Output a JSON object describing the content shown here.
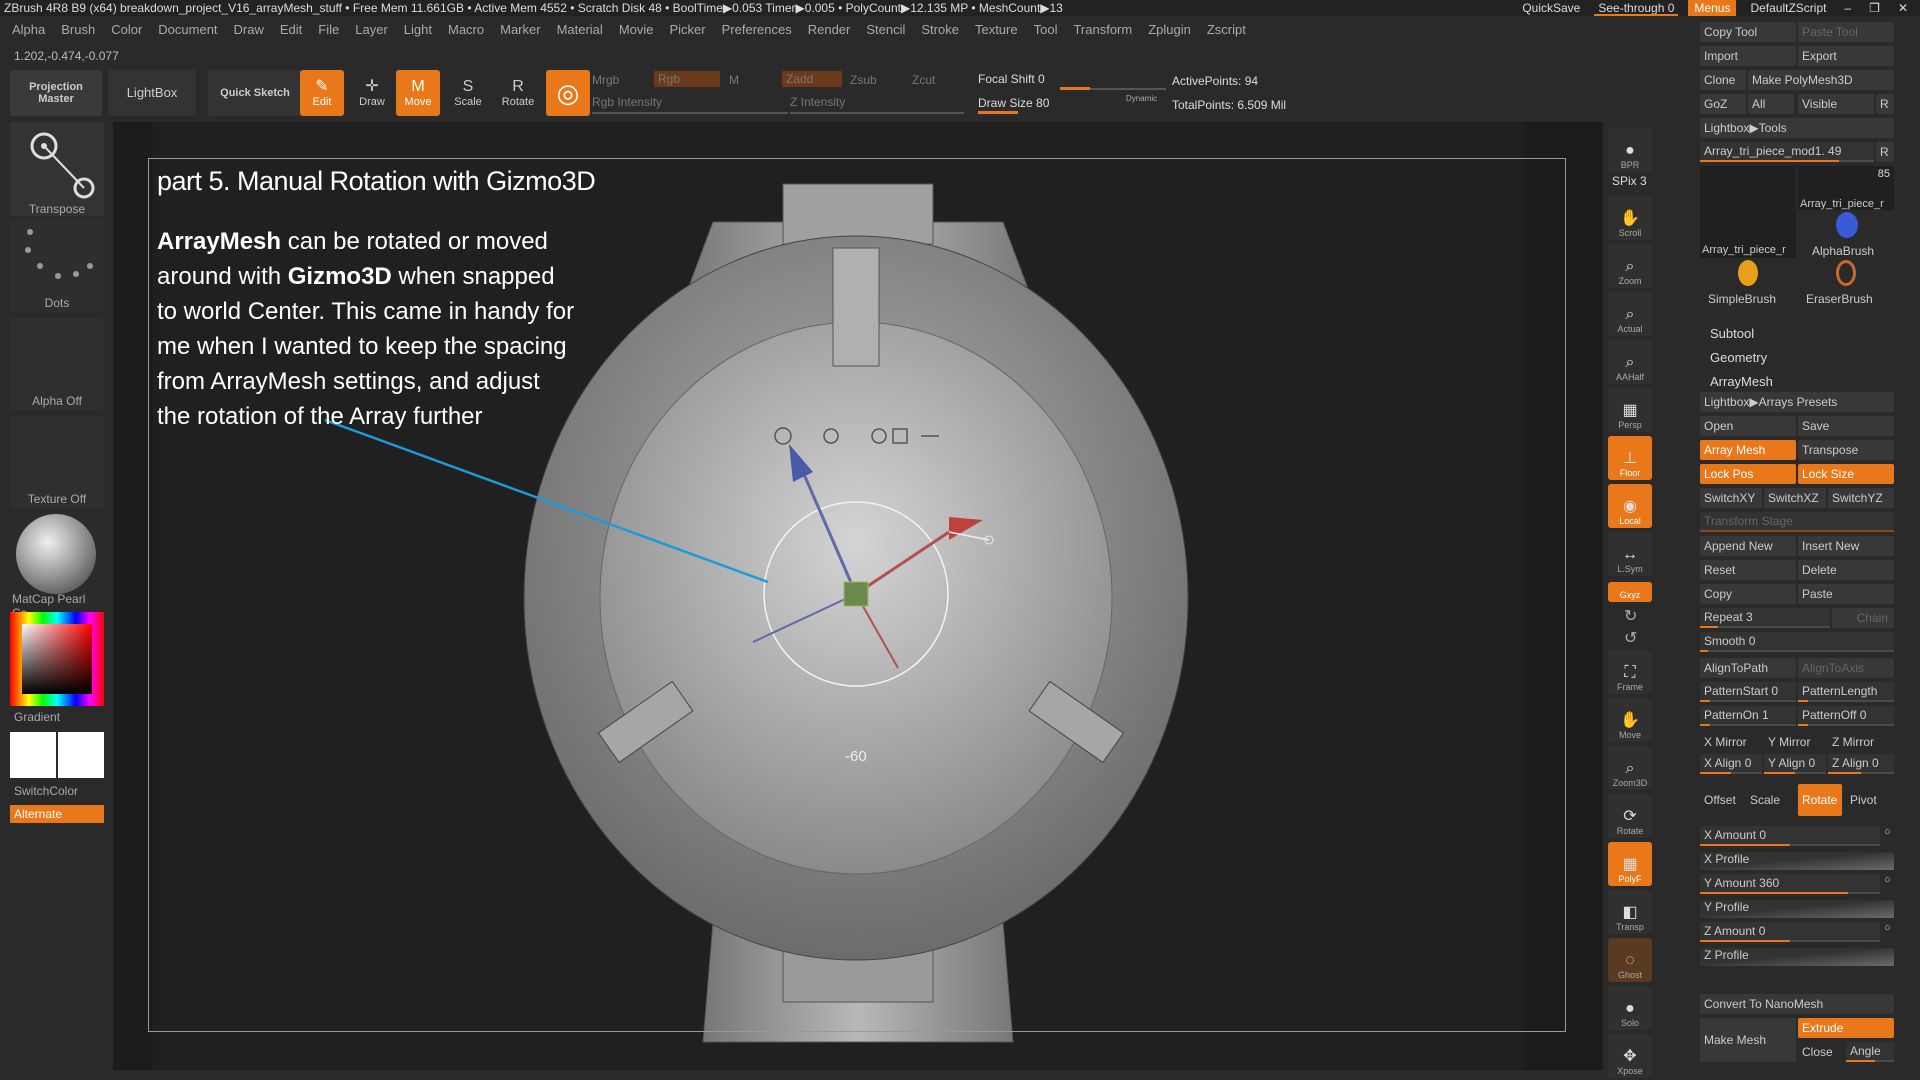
{
  "titlebar": {
    "text": "ZBrush 4R8 B9 (x64)   breakdown_project_V16_arrayMesh_stuff   • Free Mem 11.661GB • Active Mem 4552 • Scratch Disk 48 • BoolTime▶0.053 Timer▶0.005 • PolyCount▶12.135 MP • MeshCount▶13",
    "quicksave": "QuickSave",
    "see_through": "See-through  0",
    "menus": "Menus",
    "script": "DefaultZScript"
  },
  "menubar": [
    "Alpha",
    "Brush",
    "Color",
    "Document",
    "Draw",
    "Edit",
    "File",
    "Layer",
    "Light",
    "Macro",
    "Marker",
    "Material",
    "Movie",
    "Picker",
    "Preferences",
    "Render",
    "Stencil",
    "Stroke",
    "Texture",
    "Tool",
    "Transform",
    "Zplugin",
    "Zscript"
  ],
  "coords": "1.202,-0.474,-0.077",
  "toolbar": {
    "projection_master": "Projection Master",
    "lightbox": "LightBox",
    "quick_sketch": "Quick Sketch",
    "edit": "Edit",
    "draw": "Draw",
    "move": "Move",
    "scale": "Scale",
    "rotate": "Rotate",
    "mrgb": "Mrgb",
    "rgb": "Rgb",
    "m": "M",
    "zadd": "Zadd",
    "zsub": "Zsub",
    "zcut": "Zcut",
    "rgb_intensity": "Rgb Intensity",
    "z_intensity": "Z Intensity",
    "focal_shift": "Focal Shift 0",
    "draw_size": "Draw Size 80",
    "dynamic": "Dynamic",
    "active_points": "ActivePoints: 94",
    "total_points": "TotalPoints: 6.509 Mil"
  },
  "leftpanel": {
    "transpose": "Transpose",
    "dots": "Dots",
    "alpha_off": "Alpha Off",
    "texture_off": "Texture Off",
    "matcap": "MatCap Pearl Ca",
    "gradient": "Gradient",
    "switchcolor": "SwitchColor",
    "alternate": "Alternate"
  },
  "viewport": {
    "title": "part 5. Manual Rotation with Gizmo3D",
    "body_bold1": "ArrayMesh",
    "body_part1": " can be rotated or moved around with ",
    "body_bold2": "Gizmo3D",
    "body_part2": " when snapped to world Center. This came in handy for me when I wanted to keep the spacing from ArrayMesh settings, and adjust the rotation of the Array further",
    "angle_readout": "-60"
  },
  "rightbar": {
    "bpr": "BPR",
    "spix": "SPix 3",
    "scroll": "Scroll",
    "zoom": "Zoom",
    "actual": "Actual",
    "aahalf": "AAHalf",
    "persp": "Persp",
    "floor": "Floor",
    "local": "Local",
    "lsym": "L.Sym",
    "xyz": "Gxyz",
    "frame": "Frame",
    "move": "Move",
    "zoom3d": "Zoom3D",
    "rotate": "Rotate",
    "polyf": "PolyF",
    "transp": "Transp",
    "ghost": "Ghost",
    "solo": "Solo",
    "xpose": "Xpose"
  },
  "toolpanel": {
    "copy_tool": "Copy Tool",
    "paste_tool": "Paste Tool",
    "import": "Import",
    "export": "Export",
    "clone": "Clone",
    "make_polymesh": "Make PolyMesh3D",
    "goz": "GoZ",
    "all": "All",
    "visible": "Visible",
    "r": "R",
    "lightbox_tools": "Lightbox▶Tools",
    "current_tool": "Array_tri_piece_mod1. 49",
    "r2": "R",
    "thumb1_count": "85",
    "thumb1": "Array_tri_piece_r",
    "thumb2": "Array_tri_piece_r",
    "alphabrush": "AlphaBrush",
    "simplebrush": "SimpleBrush",
    "eraserbrush": "EraserBrush",
    "subtool": "Subtool",
    "geometry": "Geometry",
    "arraymesh": "ArrayMesh",
    "lightbox_arrays": "Lightbox▶Arrays Presets",
    "open": "Open",
    "save": "Save",
    "array_mesh": "Array Mesh",
    "transpose": "Transpose",
    "lock_pos": "Lock Pos",
    "lock_size": "Lock Size",
    "switchxy": "SwitchXY",
    "switchxz": "SwitchXZ",
    "switchyz": "SwitchYZ",
    "transform_stage": "Transform Stage",
    "append_new": "Append New",
    "insert_new": "Insert New",
    "reset": "Reset",
    "delete": "Delete",
    "copy": "Copy",
    "paste": "Paste",
    "repeat": "Repeat 3",
    "chain": "Chain",
    "smooth": "Smooth 0",
    "align_to_path": "AlignToPath",
    "align_to_axis": "AlignToAxis",
    "pattern_start": "PatternStart 0",
    "pattern_length": "PatternLength",
    "pattern_on": "PatternOn 1",
    "pattern_off": "PatternOff 0",
    "x_mirror": "X Mirror",
    "y_mirror": "Y Mirror",
    "z_mirror": "Z Mirror",
    "x_align": "X Align 0",
    "y_align": "Y Align 0",
    "z_align": "Z Align 0",
    "offset": "Offset",
    "scale": "Scale",
    "rotate": "Rotate",
    "pivot": "Pivot",
    "x_amount": "X Amount 0",
    "x_profile": "X Profile",
    "y_amount": "Y Amount 360",
    "y_profile": "Y Profile",
    "z_amount": "Z Amount 0",
    "z_profile": "Z Profile",
    "convert_nanomesh": "Convert To NanoMesh",
    "make_mesh": "Make Mesh",
    "extrude": "Extrude",
    "close": "Close",
    "angle": "Angle"
  }
}
